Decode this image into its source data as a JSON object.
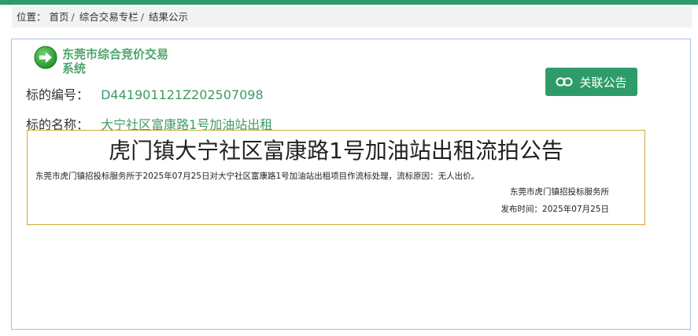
{
  "breadcrumb": {
    "prefix": "位置：",
    "items": [
      "首页",
      "综合交易专栏",
      "结果公示"
    ],
    "separator": "/"
  },
  "system": {
    "name": "东莞市综合竞价交易系统",
    "logo_icon": "arrow-right-circle-icon",
    "accent_color": "#2e9c6a"
  },
  "actions": {
    "assoc_label": "关联公告",
    "assoc_icon": "link-icon"
  },
  "fields": {
    "code_label": "标的编号：",
    "code_value": "D441901121Z202507098",
    "name_label": "标的名称：",
    "name_value": "大宁社区富康路1号加油站出租"
  },
  "notice": {
    "title": "虎门镇大宁社区富康路1号加油站出租流拍公告",
    "body": "东莞市虎门镇招投标服务所于2025年07月25日对大宁社区富康路1号加油站出租项目作流标处理，流标原因：无人出价。",
    "org": "东莞市虎门镇招投标服务所",
    "publish_date": "发布时间：2025年07月25日"
  }
}
